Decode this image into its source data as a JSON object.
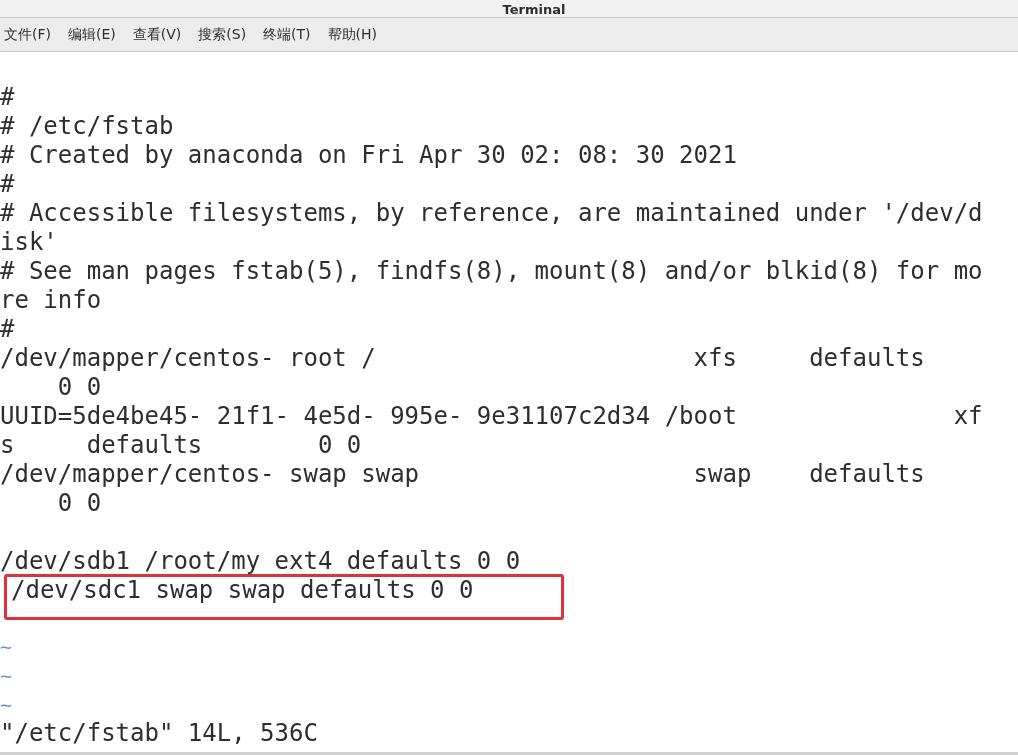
{
  "window": {
    "title": "Terminal"
  },
  "menu": [
    "文件(F)",
    "编辑(E)",
    "查看(V)",
    "搜索(S)",
    "终端(T)",
    "帮助(H)"
  ],
  "lines": [
    {
      "kind": "text",
      "text": "#",
      "highlighted": false
    },
    {
      "kind": "text",
      "text": "# /etc/fstab",
      "highlighted": false
    },
    {
      "kind": "text",
      "text": "# Created by anaconda on Fri Apr 30 02: 08: 30 2021",
      "highlighted": false
    },
    {
      "kind": "text",
      "text": "#",
      "highlighted": false
    },
    {
      "kind": "text",
      "text": "# Accessible filesystems, by reference, are maintained under '/dev/d",
      "highlighted": false
    },
    {
      "kind": "text",
      "text": "isk'",
      "highlighted": false
    },
    {
      "kind": "text",
      "text": "# See man pages fstab(5), findfs(8), mount(8) and/or blkid(8) for mo",
      "highlighted": false
    },
    {
      "kind": "text",
      "text": "re info",
      "highlighted": false
    },
    {
      "kind": "text",
      "text": "#",
      "highlighted": false
    },
    {
      "kind": "text",
      "text": "/dev/mapper/centos- root /                      xfs     defaults",
      "highlighted": false
    },
    {
      "kind": "text",
      "text": "    0 0",
      "highlighted": false
    },
    {
      "kind": "text",
      "text": "UUID=5de4be45- 21f1- 4e5d- 995e- 9e31107c2d34 /boot               xf",
      "highlighted": false
    },
    {
      "kind": "text",
      "text": "s     defaults        0 0",
      "highlighted": false
    },
    {
      "kind": "text",
      "text": "/dev/mapper/centos- swap swap                   swap    defaults",
      "highlighted": false
    },
    {
      "kind": "text",
      "text": "    0 0",
      "highlighted": false
    },
    {
      "kind": "blank",
      "highlighted": false
    },
    {
      "kind": "text",
      "text": "/dev/sdb1 /root/my ext4 defaults 0 0",
      "highlighted": false
    },
    {
      "kind": "text",
      "text": "/dev/sdc1 swap swap defaults 0 0",
      "highlighted": true
    },
    {
      "kind": "blank",
      "highlighted": false
    },
    {
      "kind": "tilde",
      "text": "~",
      "highlighted": false
    },
    {
      "kind": "tilde",
      "text": "~",
      "highlighted": false
    },
    {
      "kind": "tilde",
      "text": "~",
      "highlighted": false
    },
    {
      "kind": "status",
      "text": "\"/etc/fstab\" 14L, 536C",
      "highlighted": false
    }
  ]
}
